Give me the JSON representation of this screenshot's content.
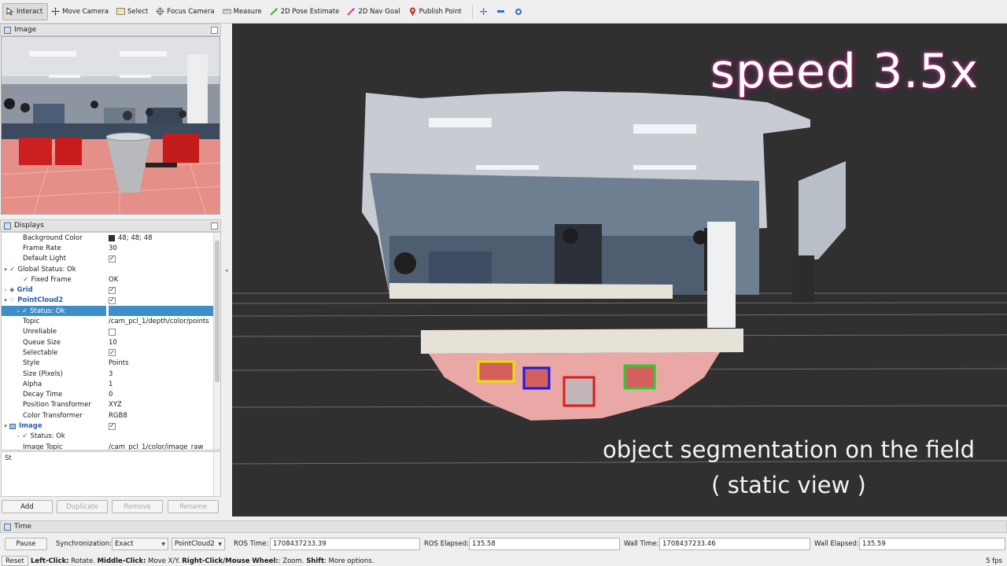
{
  "toolbar": {
    "tools": [
      "Interact",
      "Move Camera",
      "Select",
      "Focus Camera",
      "Measure",
      "2D Pose Estimate",
      "2D Nav Goal",
      "Publish Point"
    ]
  },
  "image_panel": {
    "title": "Image"
  },
  "displays_panel": {
    "title": "Displays",
    "rows": [
      {
        "name": "Background Color",
        "value": "48; 48; 48"
      },
      {
        "name": "Frame Rate",
        "value": "30"
      },
      {
        "name": "Default Light",
        "value": "✓"
      },
      {
        "name": "Global Status: Ok",
        "value": ""
      },
      {
        "name": "Fixed Frame",
        "value": "OK"
      },
      {
        "name": "Grid",
        "value": "✓"
      },
      {
        "name": "PointCloud2",
        "value": "✓"
      },
      {
        "name": "Status: Ok",
        "value": ""
      },
      {
        "name": "Topic",
        "value": "/cam_pcl_1/depth/color/points"
      },
      {
        "name": "Unreliable",
        "value": ""
      },
      {
        "name": "Queue Size",
        "value": "10"
      },
      {
        "name": "Selectable",
        "value": "✓"
      },
      {
        "name": "Style",
        "value": "Points"
      },
      {
        "name": "Size (Pixels)",
        "value": "3"
      },
      {
        "name": "Alpha",
        "value": "1"
      },
      {
        "name": "Decay Time",
        "value": "0"
      },
      {
        "name": "Position Transformer",
        "value": "XYZ"
      },
      {
        "name": "Color Transformer",
        "value": "RGB8"
      },
      {
        "name": "Image",
        "value": "✓"
      },
      {
        "name": "Status: Ok",
        "value": ""
      },
      {
        "name": "Image Topic",
        "value": "/cam_pcl_1/color/image_raw"
      }
    ],
    "description": "St",
    "buttons": {
      "add": "Add",
      "duplicate": "Duplicate",
      "remove": "Remove",
      "rename": "Rename"
    }
  },
  "view": {
    "speed_label": "speed 3.5x",
    "caption_line1": "object segmentation on the field",
    "caption_line2": "( static view )",
    "background": "#303030",
    "box_colors": [
      "#e8e000",
      "#1a1ae0",
      "#e01a1a",
      "#2ad02a"
    ]
  },
  "time_panel": {
    "title": "Time",
    "pause": "Pause",
    "sync_label": "Synchronization:",
    "sync_value": "Exact",
    "sync_source": "PointCloud2",
    "ros_time_label": "ROS Time:",
    "ros_time": "1708437233.39",
    "ros_elapsed_label": "ROS Elapsed:",
    "ros_elapsed": "135.58",
    "wall_time_label": "Wall Time:",
    "wall_time": "1708437233.46",
    "wall_elapsed_label": "Wall Elapsed:",
    "wall_elapsed": "135.59"
  },
  "status_bar": {
    "reset": "Reset",
    "hint_left_click": "Left-Click:",
    "hint_rotate": " Rotate. ",
    "hint_middle_click": "Middle-Click:",
    "hint_move": " Move X/Y. ",
    "hint_right_click": "Right-Click/Mouse Wheel:",
    "hint_zoom": ": Zoom. ",
    "hint_shift": "Shift",
    "hint_more": ": More options.",
    "fps": "5 fps"
  }
}
